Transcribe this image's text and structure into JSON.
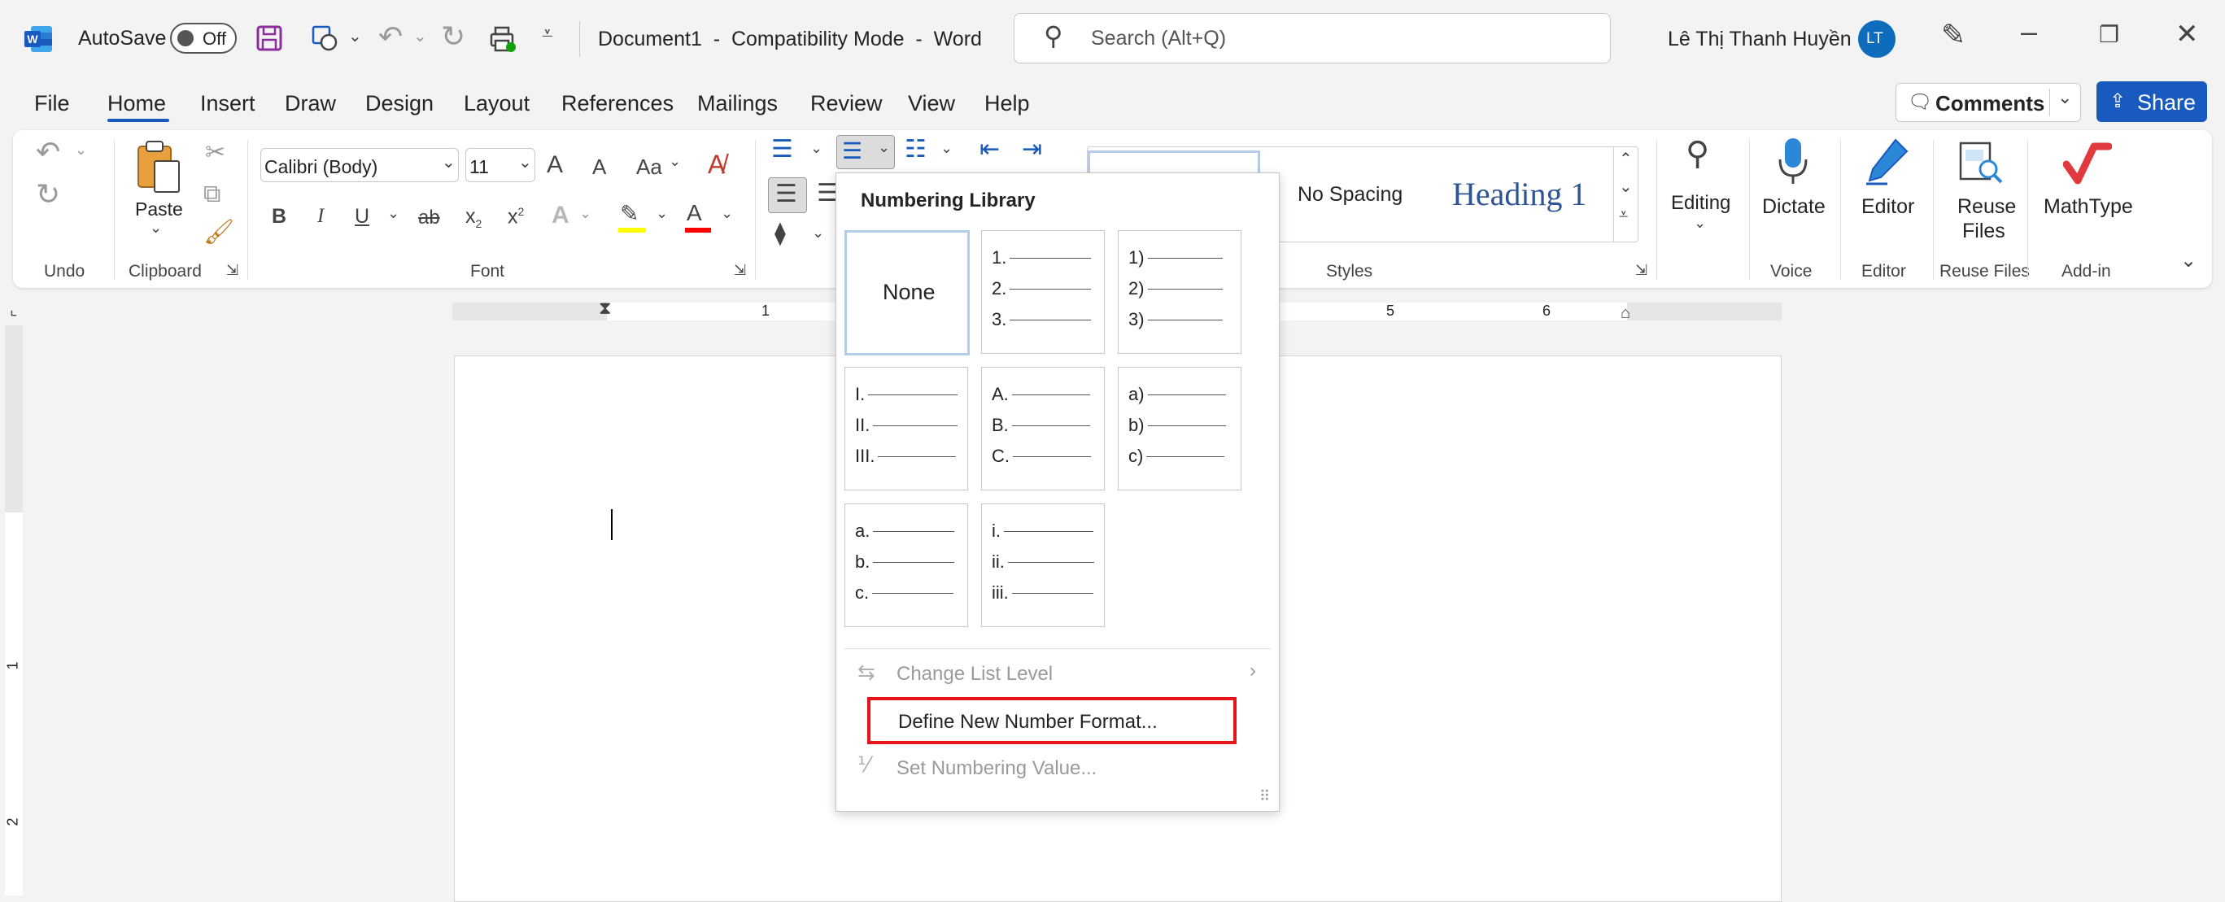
{
  "titlebar": {
    "autosave_label": "AutoSave",
    "autosave_state": "Off",
    "doc_title": "Document1  -  Compatibility Mode  -  Word",
    "search_placeholder": "Search (Alt+Q)",
    "user_name": "Lê Thị Thanh Huyền",
    "user_initials": "LT"
  },
  "tabs": [
    "File",
    "Home",
    "Insert",
    "Draw",
    "Design",
    "Layout",
    "References",
    "Mailings",
    "Review",
    "View",
    "Help"
  ],
  "actions": {
    "comments": "Comments",
    "share": "Share"
  },
  "ribbon": {
    "groups": {
      "undo": "Undo",
      "clipboard": "Clipboard",
      "font": "Font",
      "styles": "Styles",
      "voice": "Voice",
      "editor": "Editor",
      "reuse_files": "Reuse Files",
      "addin": "Add-in"
    },
    "paste_label": "Paste",
    "font_name": "Calibri (Body)",
    "font_size": "11",
    "bold": "B",
    "italic": "I",
    "underline": "U",
    "strike": "ab",
    "subscript_base": "x",
    "subscript_mark": "2",
    "superscript_base": "x",
    "superscript_mark": "2",
    "grow_font": "A",
    "shrink_font": "A",
    "change_case": "Aa",
    "text_effects": "A",
    "font_color": "A",
    "styles": {
      "no_spacing": "No Spacing",
      "heading1": "Heading 1"
    },
    "editing": "Editing",
    "dictate": "Dictate",
    "editor_btn": "Editor",
    "reuse_line1": "Reuse",
    "reuse_line2": "Files",
    "mathtype": "MathType"
  },
  "colors": {
    "accent": "#185abd",
    "highlight": "#ffff00",
    "font_color_bar": "#ff0000",
    "callout": "#e8141c"
  },
  "ruler": {
    "h_marks": [
      "1",
      "5",
      "6"
    ],
    "v_marks": [
      "1",
      "2"
    ]
  },
  "numbering_menu": {
    "header": "Numbering Library",
    "none_label": "None",
    "formats": [
      [
        "1.",
        "2.",
        "3."
      ],
      [
        "1)",
        "2)",
        "3)"
      ],
      [
        "I.",
        "II.",
        "III."
      ],
      [
        "A.",
        "B.",
        "C."
      ],
      [
        "a)",
        "b)",
        "c)"
      ],
      [
        "a.",
        "b.",
        "c."
      ],
      [
        "i.",
        "ii.",
        "iii."
      ]
    ],
    "change_list_level": "Change List Level",
    "define_new": "Define New Number Format...",
    "set_value": "Set Numbering Value..."
  }
}
